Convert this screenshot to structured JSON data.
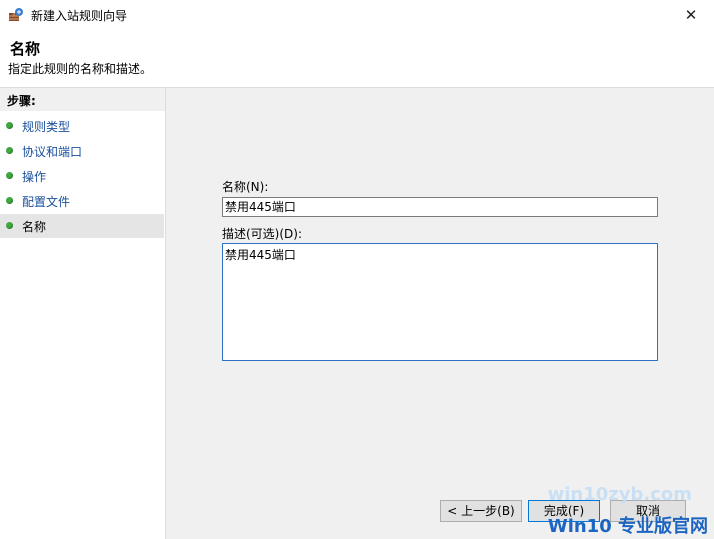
{
  "window": {
    "title": "新建入站规则向导",
    "close_glyph": "✕"
  },
  "header": {
    "title": "名称",
    "subtitle": "指定此规则的名称和描述。"
  },
  "sidebar": {
    "title": "步骤:",
    "items": [
      {
        "label": "规则类型",
        "active": false
      },
      {
        "label": "协议和端口",
        "active": false
      },
      {
        "label": "操作",
        "active": false
      },
      {
        "label": "配置文件",
        "active": false
      },
      {
        "label": "名称",
        "active": true
      }
    ]
  },
  "form": {
    "name_label": "名称(N):",
    "name_value": "禁用445端口",
    "description_label": "描述(可选)(D):",
    "description_value": "禁用445端口"
  },
  "buttons": {
    "back": "< 上一步(B)",
    "finish": "完成(F)",
    "cancel": "取消"
  },
  "watermark": {
    "top": "win10zyb.com",
    "bottom": "Win10 专业版官网"
  },
  "colors": {
    "accent": "#0078d7",
    "link": "#1a4f9c",
    "step_dot": "#3fa83f",
    "content_bg": "#f0f0f0"
  }
}
